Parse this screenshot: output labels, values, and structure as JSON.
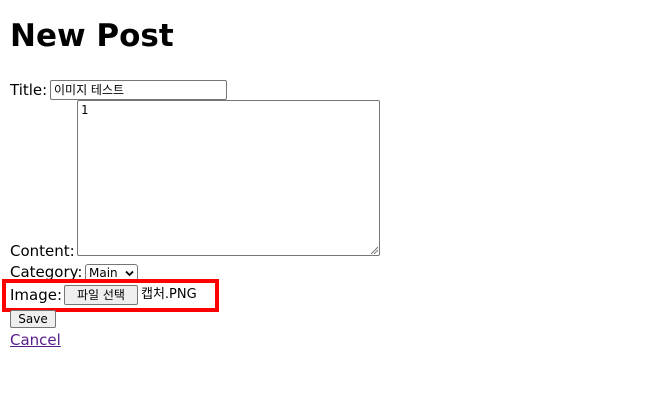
{
  "page": {
    "heading": "New Post"
  },
  "form": {
    "title_label": "Title:",
    "title_value": "이미지 테스트",
    "content_label": "Content:",
    "content_value": "1",
    "category_label": "Category:",
    "category_selected": "Main",
    "image_label": "Image:",
    "file_button_label": "파일 선택",
    "file_name": "캡처.PNG",
    "save_label": "Save",
    "cancel_label": "Cancel"
  },
  "icons": {
    "select_chevron": "chevron-down-icon",
    "resize_grip": "resize-grip-icon"
  },
  "colors": {
    "highlight": "#ff0000",
    "visited_link": "#551a8b"
  }
}
